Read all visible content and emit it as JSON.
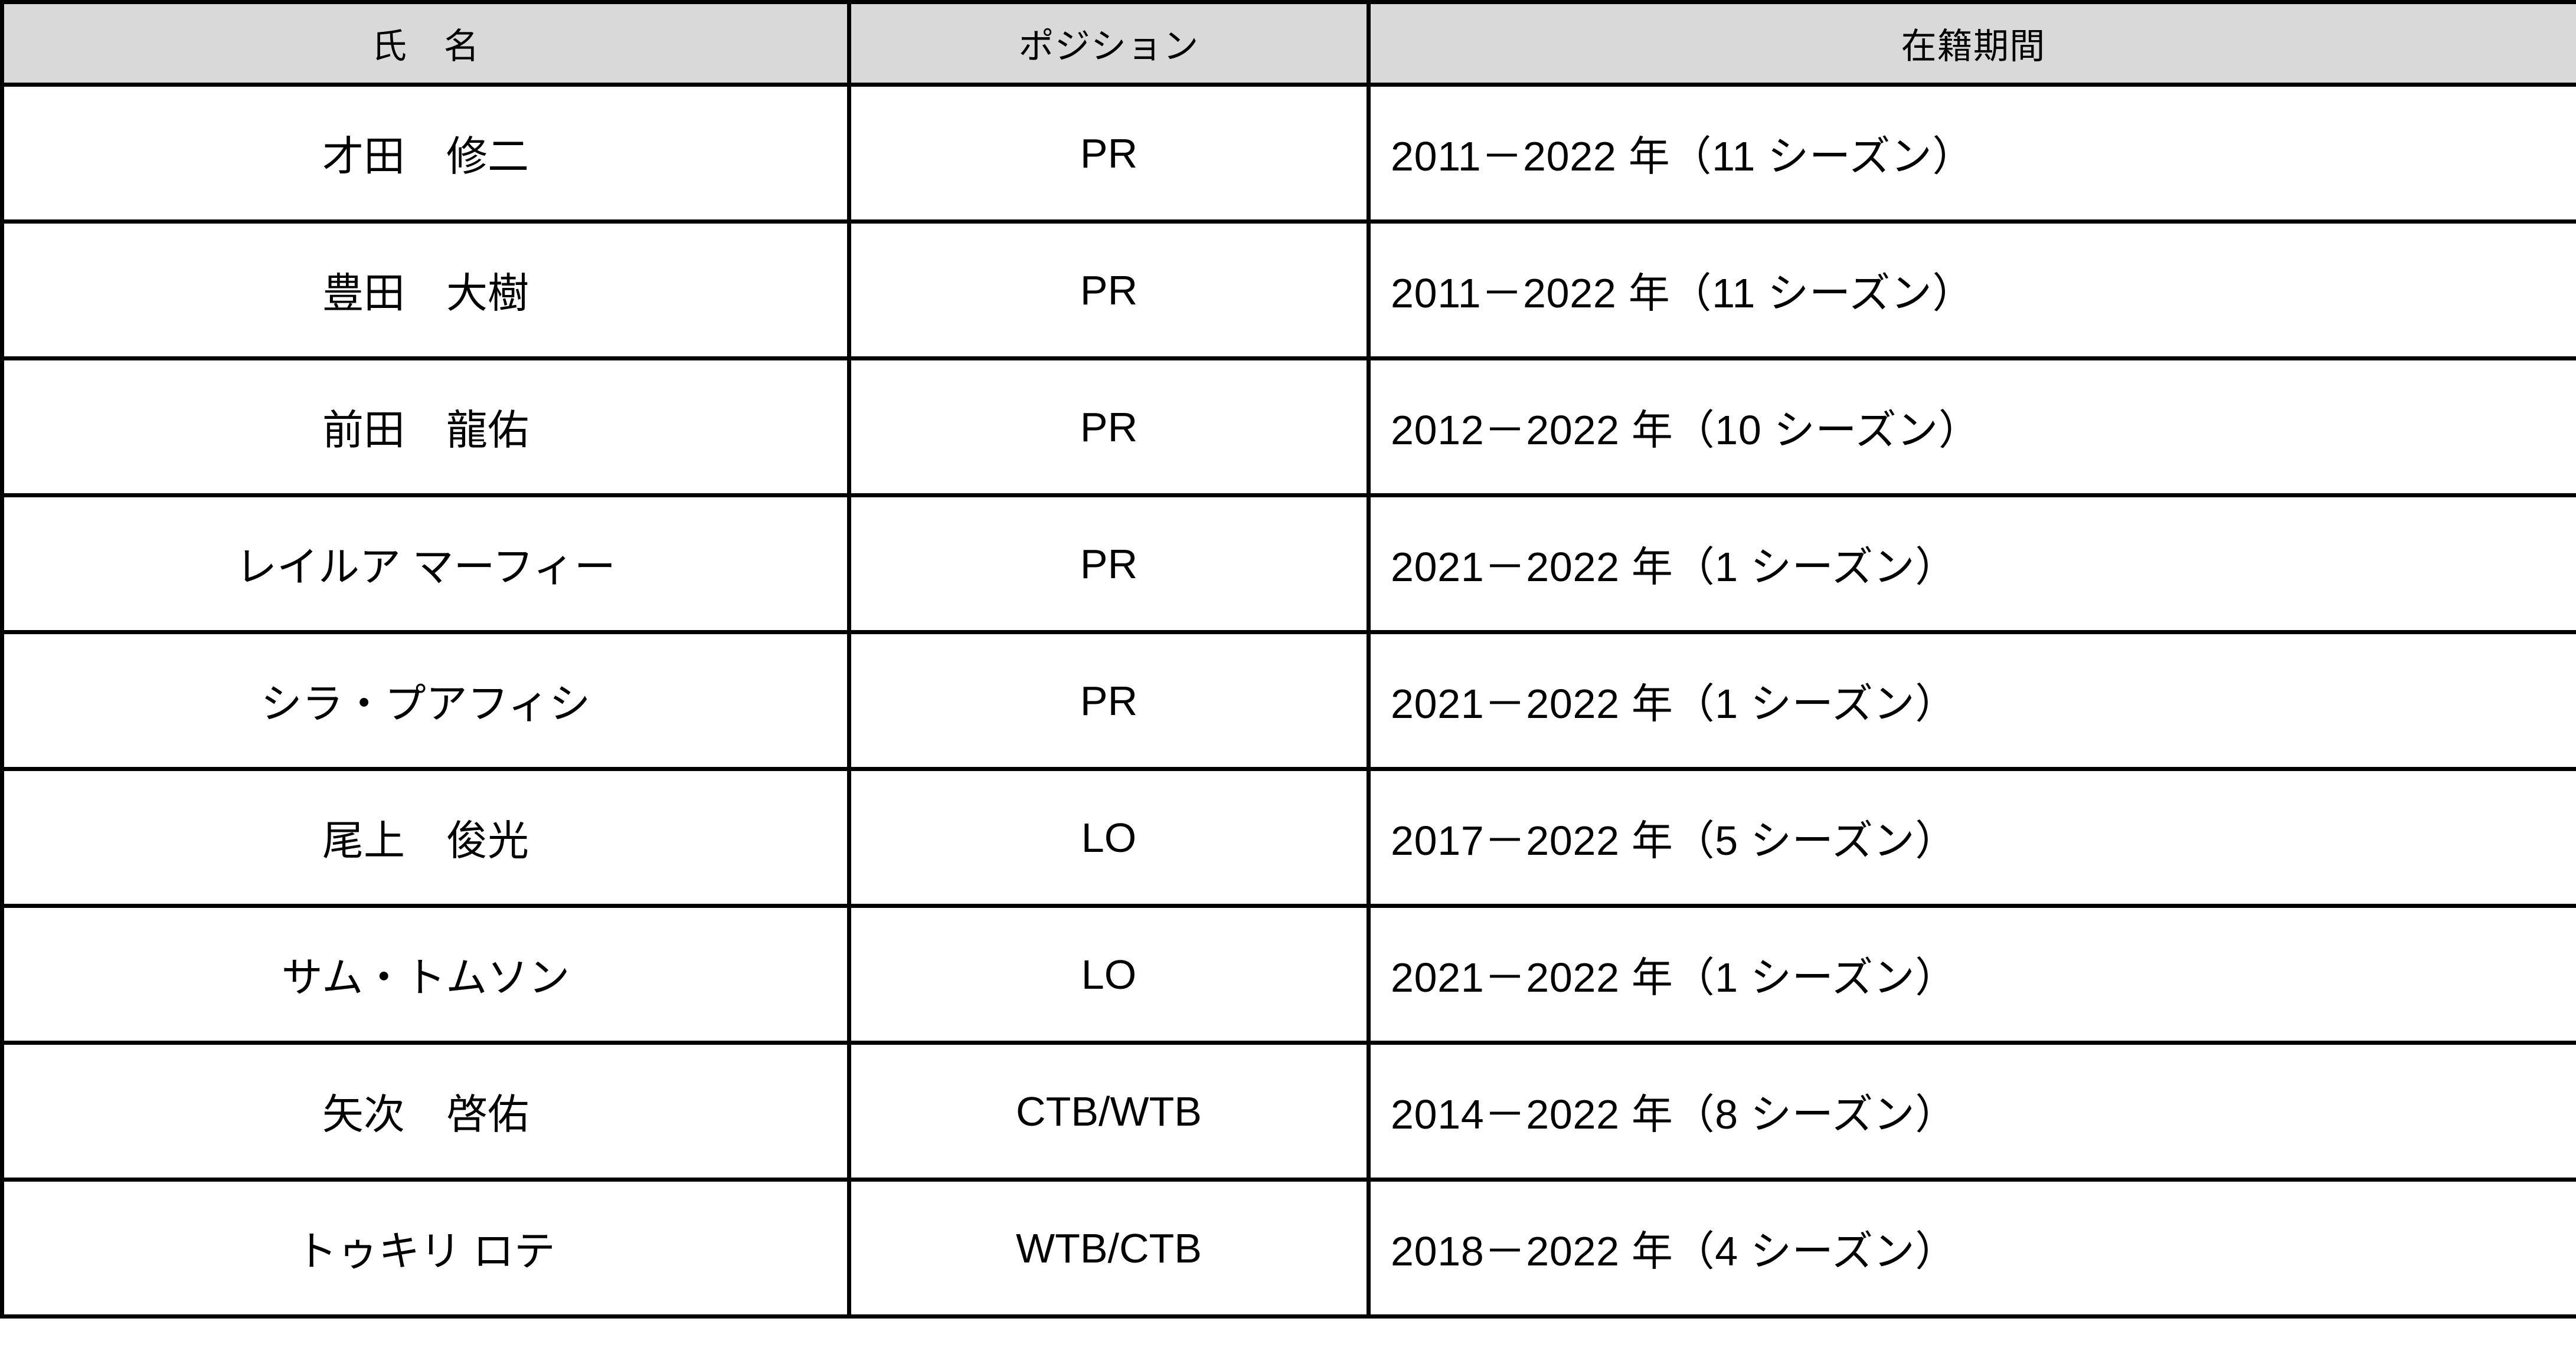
{
  "table": {
    "columns": [
      {
        "key": "name",
        "label": "氏　名",
        "align": "center"
      },
      {
        "key": "position",
        "label": "ポジション",
        "align": "center"
      },
      {
        "key": "tenure",
        "label": "在籍期間",
        "align": "left"
      }
    ],
    "header_background": "#d9d9d9",
    "border_color": "#000000",
    "rows": [
      {
        "name": "才田　修二",
        "position": "PR",
        "tenure": "2011－2022 年（11 シーズン）"
      },
      {
        "name": "豊田　大樹",
        "position": "PR",
        "tenure": "2011－2022 年（11 シーズン）"
      },
      {
        "name": "前田　龍佑",
        "position": "PR",
        "tenure": "2012－2022 年（10 シーズン）"
      },
      {
        "name": "レイルア マーフィー",
        "position": "PR",
        "tenure": "2021－2022 年（1 シーズン）"
      },
      {
        "name": "シラ・プアフィシ",
        "position": "PR",
        "tenure": "2021－2022 年（1 シーズン）"
      },
      {
        "name": "尾上　俊光",
        "position": "LO",
        "tenure": "2017－2022 年（5 シーズン）"
      },
      {
        "name": "サム・トムソン",
        "position": "LO",
        "tenure": "2021－2022 年（1 シーズン）"
      },
      {
        "name": "矢次　啓佑",
        "position": "CTB/WTB",
        "tenure": "2014－2022 年（8 シーズン）"
      },
      {
        "name": "トゥキリ ロテ",
        "position": "WTB/CTB",
        "tenure": "2018－2022 年（4 シーズン）"
      }
    ]
  }
}
